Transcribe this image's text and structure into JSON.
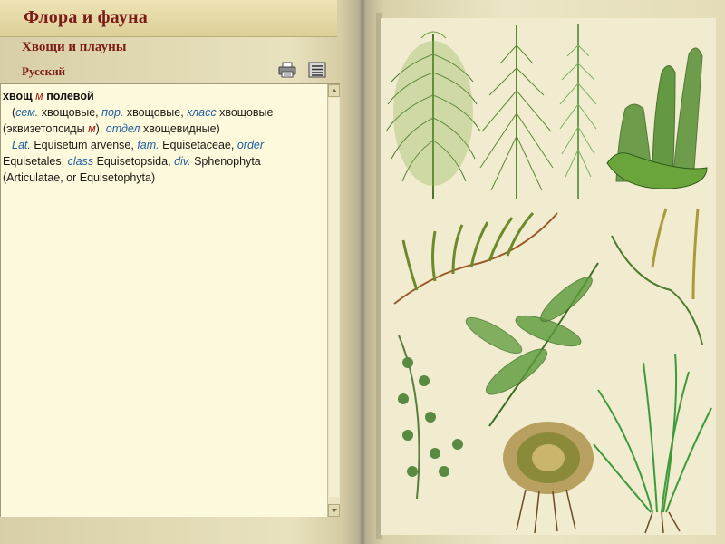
{
  "header": {
    "title": "Флора и фауна",
    "subtitle": "Хвощи и плауны",
    "language": "Русский"
  },
  "toolbar": {
    "print_icon": "printer-icon",
    "list_icon": "list-icon"
  },
  "article": {
    "headword": "хвощ",
    "gender": "м",
    "headword_suffix": "полевой",
    "ru_sem_abbr": "сем.",
    "ru_sem": "хвощовые,",
    "ru_por_abbr": "пор.",
    "ru_por": "хвощовые,",
    "ru_class_abbr": "класс",
    "ru_class": "хвощовые",
    "ru_class_2": "(эквизетопсиды",
    "ru_class_2_gender": "м",
    "ru_class_2_close": "),",
    "ru_otdel_abbr": "отдел",
    "ru_otdel": "хвощевидные)",
    "lat_abbr": "Lat.",
    "lat_name": "Equisetum arvense,",
    "fam_abbr": "fam.",
    "fam": "Equisetaceae,",
    "order_abbr": "order",
    "order": "Equisetales,",
    "class_abbr": "class",
    "class": "Equisetopsida,",
    "div_abbr": "div.",
    "div": "Sphenophyta",
    "div_alt": "(Articulatae, or Equisetophyta)"
  },
  "colors": {
    "title": "#7d1b16",
    "abbr": "#1f5f9f",
    "gender": "#a01d16",
    "panel": "#fdf9dd"
  }
}
